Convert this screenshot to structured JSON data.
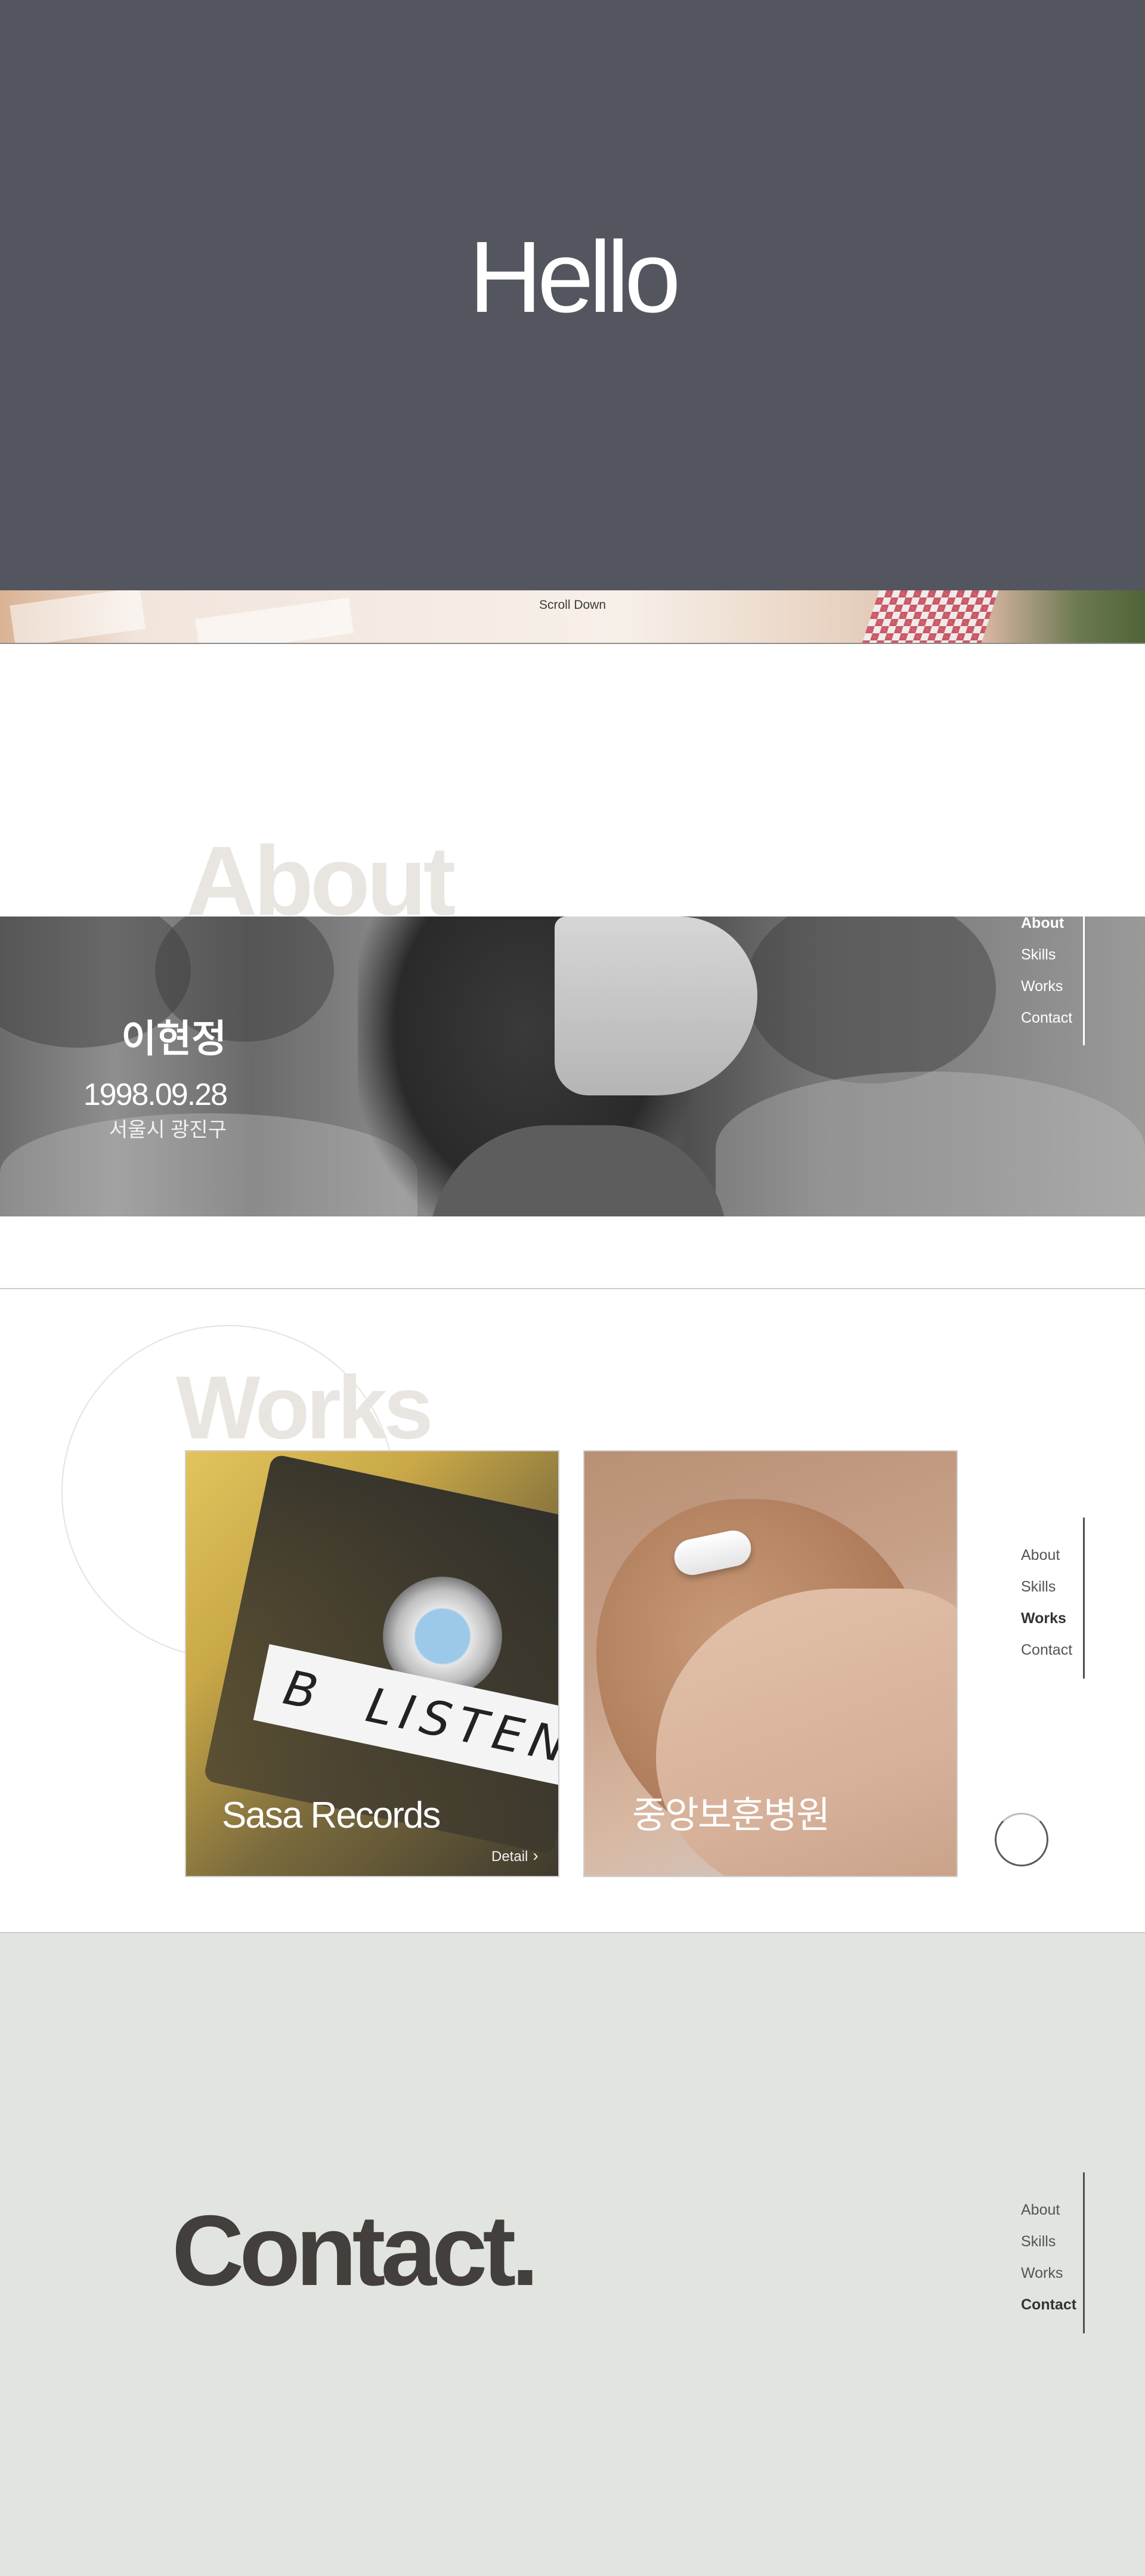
{
  "hero": {
    "title": "Hello",
    "scroll_label": "Scroll Down",
    "background_color": "#54565f"
  },
  "about": {
    "heading": "About",
    "name": "이현정",
    "birth": "1998.09.28",
    "location": "서울시 광진구"
  },
  "nav": {
    "items": [
      "About",
      "Skills",
      "Works",
      "Contact"
    ]
  },
  "works": {
    "heading": "Works",
    "cards": [
      {
        "title": "Sasa Records",
        "detail_label": "Detail",
        "detail_icon": "chevron-right-icon"
      },
      {
        "title": "중앙보훈병원"
      }
    ],
    "loader_icon": "circle-loader-icon"
  },
  "contact": {
    "heading": "Contact.",
    "background_color": "#e2e5df"
  }
}
